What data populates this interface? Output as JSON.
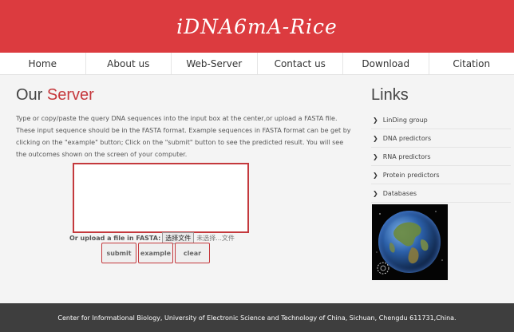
{
  "header": {
    "logo_text": "iDNA6mA-Rice",
    "brand_color": "#dc3b3f"
  },
  "nav": {
    "items": [
      "Home",
      "About us",
      "Web-Server",
      "Contact us",
      "Download",
      "Citation"
    ]
  },
  "main": {
    "title_prefix": "Our",
    "title_accent": "Server",
    "description": "Type or copy/paste the query DNA sequences into the input box at the center,or upload a FASTA file. These input sequence should be in the FASTA format. Example sequences in FASTA format can be get by clicking on the \"example\" button; Click on the \"submit\" button to see the predicted result. You will see the outcomes shown on the screen of your computer.",
    "sequence_value": "",
    "upload_label": "Or upload a file in FASTA:",
    "file_button_label": "选择文件",
    "file_status": "未选择...文件",
    "buttons": {
      "submit": "submit",
      "example": "example",
      "clear": "clear"
    }
  },
  "links": {
    "title": "Links",
    "items": [
      "LinDing group",
      "DNA predictors",
      "RNA predictors",
      "Protein predictors",
      "Databases"
    ],
    "image_icon": "globe-icon"
  },
  "footer": {
    "text": "Center for Informational Biology, University of Electronic Science and Technology of China, Sichuan, Chengdu 611731,China."
  }
}
